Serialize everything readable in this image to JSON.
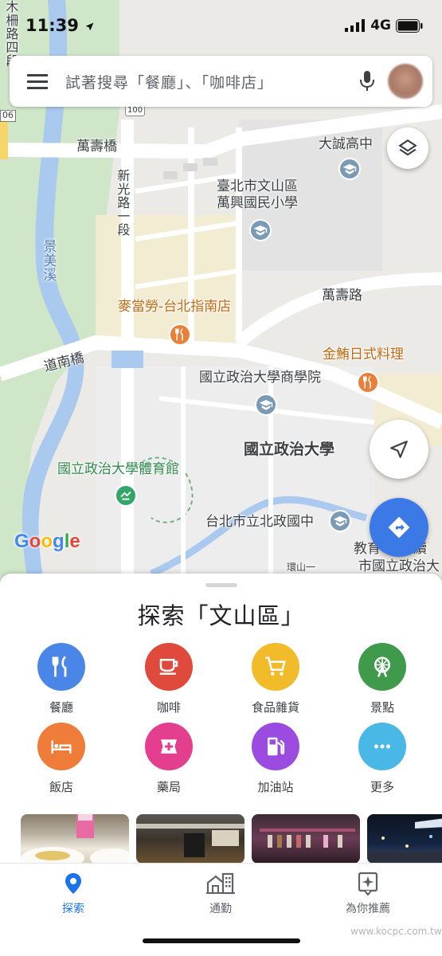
{
  "status_bar": {
    "time": "11:39",
    "network": "4G"
  },
  "search": {
    "placeholder": "試著搜尋「餐廳」、「咖啡店」"
  },
  "map": {
    "labels": {
      "road_tl": "木柵路四段",
      "road_left": "06",
      "bridge_wanshou": "萬壽橋",
      "road_xinguang": "新光路一段",
      "stream": "景美溪",
      "school_dacheng": "大誠高中",
      "district": "臺北市文山區",
      "school_wanxing": "萬興國民小學",
      "mcdonalds": "麥當勞-台北指南店",
      "road_wanshou": "萬壽路",
      "bridge_daonan": "道南橋",
      "jinwei": "金鮪日式料理",
      "nccu_business": "國立政治大學商學院",
      "nccu": "國立政治大學",
      "nccu_gym": "國立政治大學體育館",
      "beizheng": "台北市立北政國中",
      "jiaoyu": "教育",
      "continuing": "家續",
      "edu_tail": "市國立政治大",
      "huanshan": "環山一",
      "road_shield": "100"
    },
    "google_logo": "Google",
    "colors": {
      "park": "#cfe6c9",
      "water": "#aac9ee",
      "campus": "#ececec",
      "commercial": "#f5ecc9"
    }
  },
  "sheet": {
    "title": "探索「文山區」",
    "categories": [
      {
        "label": "餐廳",
        "icon": "restaurant-icon",
        "color": "#4a86e8"
      },
      {
        "label": "咖啡",
        "icon": "coffee-icon",
        "color": "#e04a3c"
      },
      {
        "label": "食品雜貨",
        "icon": "cart-icon",
        "color": "#f2bb2a"
      },
      {
        "label": "景點",
        "icon": "attraction-icon",
        "color": "#3f9a4b"
      },
      {
        "label": "飯店",
        "icon": "hotel-icon",
        "color": "#ef7c38"
      },
      {
        "label": "藥局",
        "icon": "pharmacy-icon",
        "color": "#e43f8f"
      },
      {
        "label": "加油站",
        "icon": "gas-icon",
        "color": "#9c4be0"
      },
      {
        "label": "更多",
        "icon": "more-icon",
        "color": "#4ab8e6"
      }
    ]
  },
  "nav": {
    "items": [
      {
        "label": "探索",
        "icon": "location-pin-icon",
        "active": true
      },
      {
        "label": "通勤",
        "icon": "commute-icon",
        "active": false
      },
      {
        "label": "為你推薦",
        "icon": "for-you-icon",
        "active": false
      }
    ],
    "accent": "#1a73e8"
  },
  "watermark": "www.kocpc.com.tw"
}
